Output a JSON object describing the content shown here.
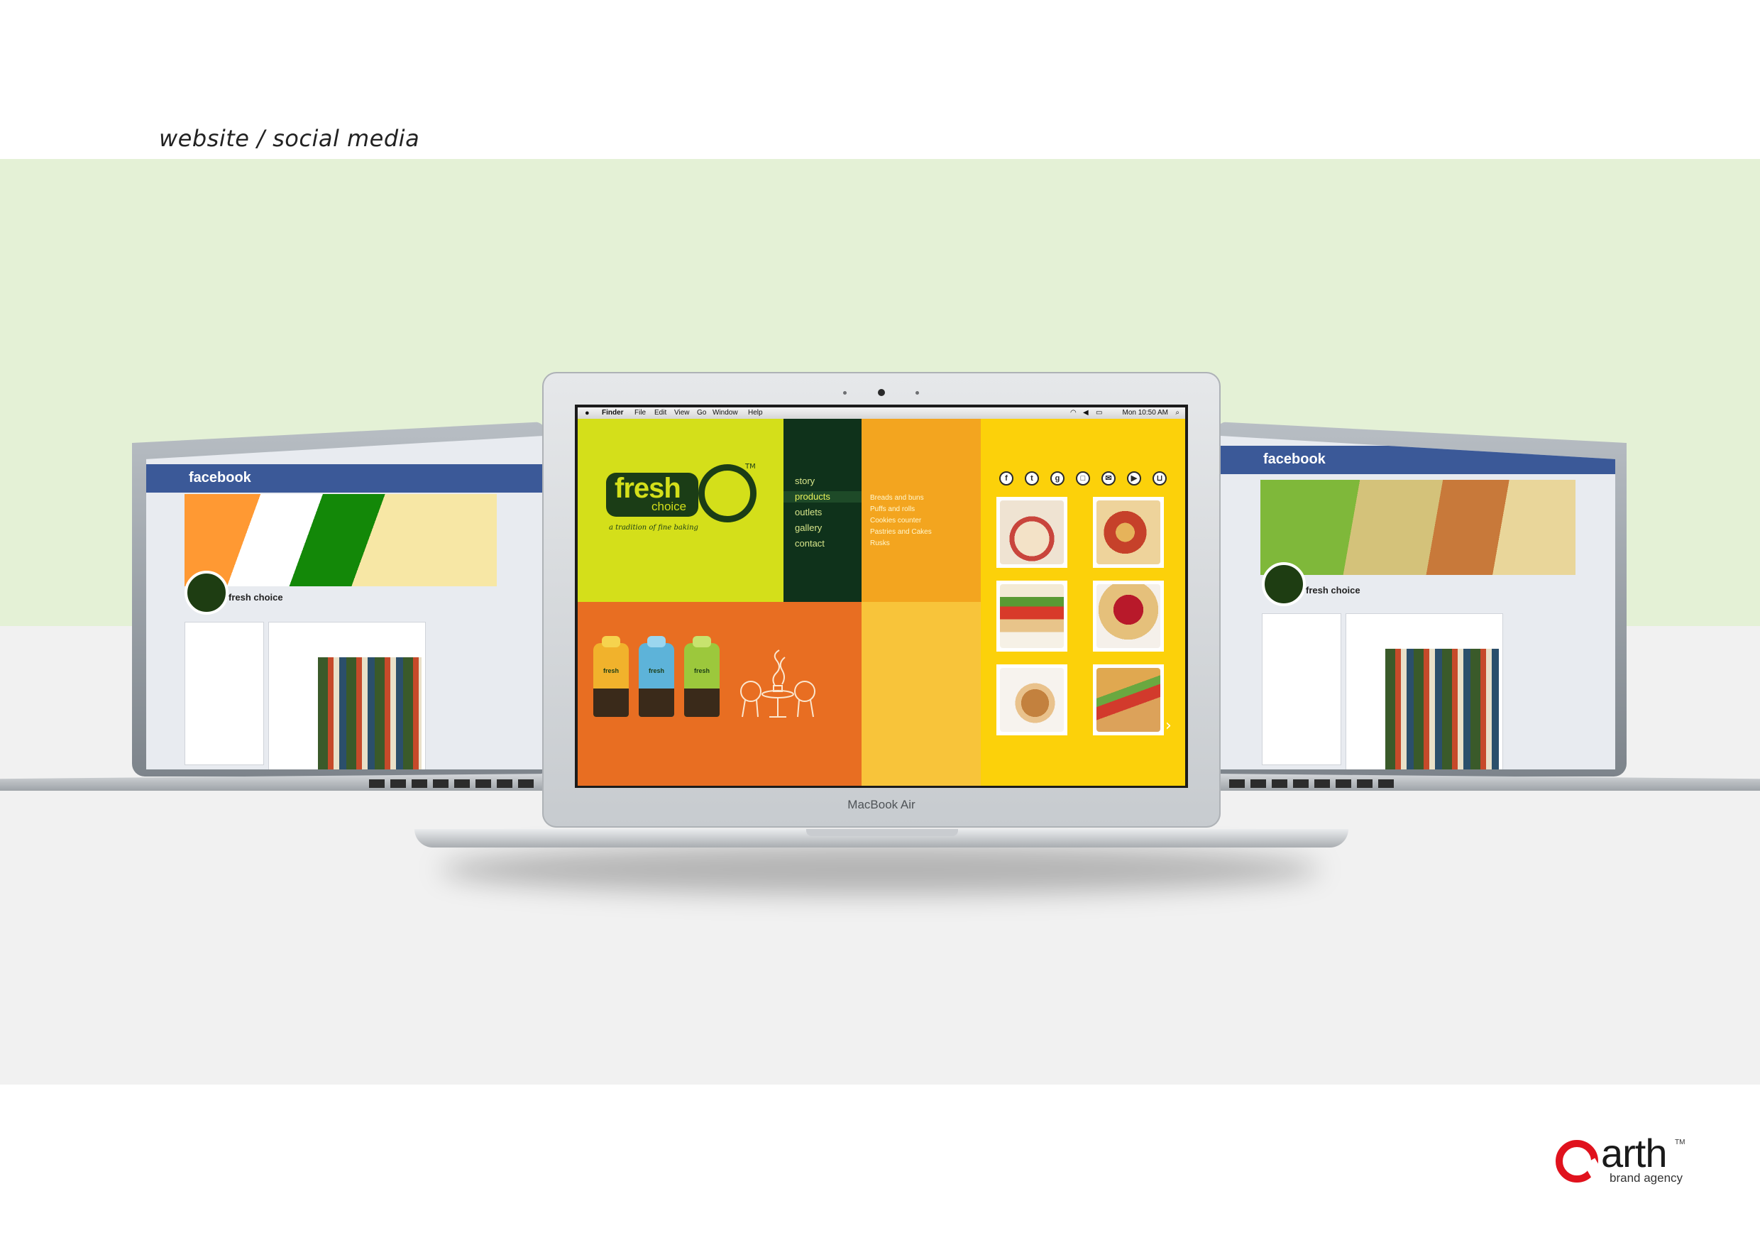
{
  "caption": "website / social media",
  "menubar": {
    "apple": "",
    "items": [
      "Finder",
      "File",
      "Edit",
      "View",
      "Go",
      "Window",
      "Help"
    ],
    "clock": "Mon 10:50 AM"
  },
  "device": {
    "main_label": "MacBook Air"
  },
  "website": {
    "logo": {
      "word1": "fresh",
      "word2": "choice",
      "tm": "TM",
      "tagline": "a tradition of fine baking"
    },
    "nav": [
      "story",
      "products",
      "outlets",
      "gallery",
      "contact"
    ],
    "active_nav": "products",
    "product_categories": [
      "Breads and buns",
      "Puffs and rolls",
      "Cookies counter",
      "Pastries and Cakes",
      "Rusks"
    ],
    "bag_labels": [
      "fresh",
      "fresh",
      "fresh"
    ],
    "social_icons": [
      "facebook-icon",
      "twitter-icon",
      "google-plus-icon",
      "instagram-icon",
      "mail-icon",
      "youtube-icon",
      "cart-icon"
    ],
    "next_arrow": "›",
    "colors": {
      "lime": "#d4df1a",
      "dark_green": "#0f321b",
      "orange": "#e86e22",
      "amber": "#f3a51f",
      "gold": "#f8c43a",
      "yellow": "#fcd10a"
    }
  },
  "facebook_left": {
    "logo": "facebook",
    "page_name": "fresh choice"
  },
  "facebook_right": {
    "logo": "facebook",
    "page_name": "fresh choice"
  },
  "agency": {
    "name": "arth",
    "tm": "TM",
    "sub": "brand agency",
    "color": "#e0121d"
  }
}
